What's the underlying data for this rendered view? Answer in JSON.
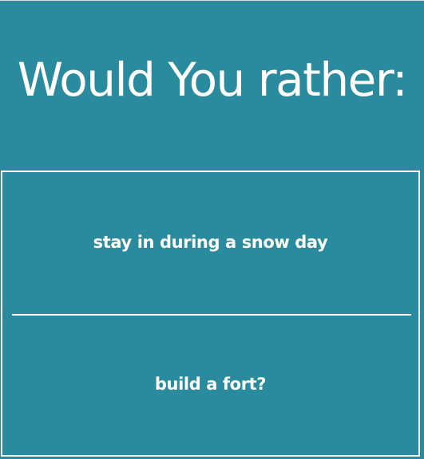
{
  "header": {
    "title": "Would You rather:"
  },
  "options": {
    "first": "stay in during a snow day",
    "second": "build a fort?"
  },
  "colors": {
    "background": "#2a8b9e",
    "text": "#ffffff",
    "border": "#ffffff"
  }
}
